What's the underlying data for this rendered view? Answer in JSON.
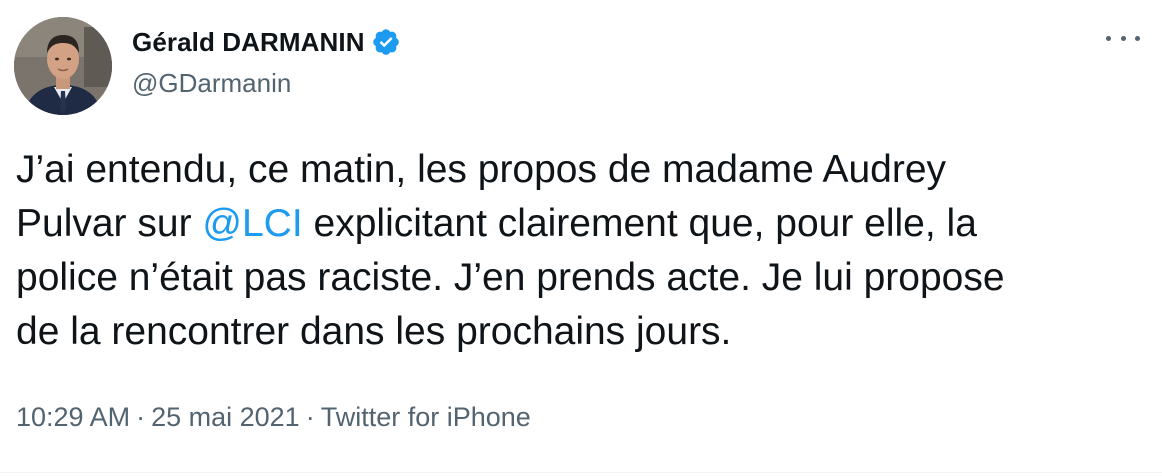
{
  "author": {
    "display_name": "Gérald DARMANIN",
    "handle": "@GDarmanin",
    "verified": true,
    "avatar_icon": "profile-photo"
  },
  "tweet": {
    "line1": "J’ai entendu, ce matin, les propos de madame Audrey",
    "line2_pre": "Pulvar sur ",
    "mention": "@LCI",
    "line2_post": " explicitant clairement que, pour elle, la",
    "line3": "police n’était pas raciste. J’en prends acte. Je lui propose",
    "line4": "de la rencontrer dans les prochains jours."
  },
  "meta": {
    "time": "10:29 AM",
    "date": "25 mai 2021",
    "separator": "·",
    "source": "Twitter for iPhone"
  },
  "colors": {
    "text": "#0f1419",
    "secondary": "#536471",
    "link": "#1d9bf0",
    "verified_badge": "#1d9bf0"
  },
  "icons": {
    "more": "more-horizontal-icon",
    "verified": "verified-badge-icon"
  }
}
